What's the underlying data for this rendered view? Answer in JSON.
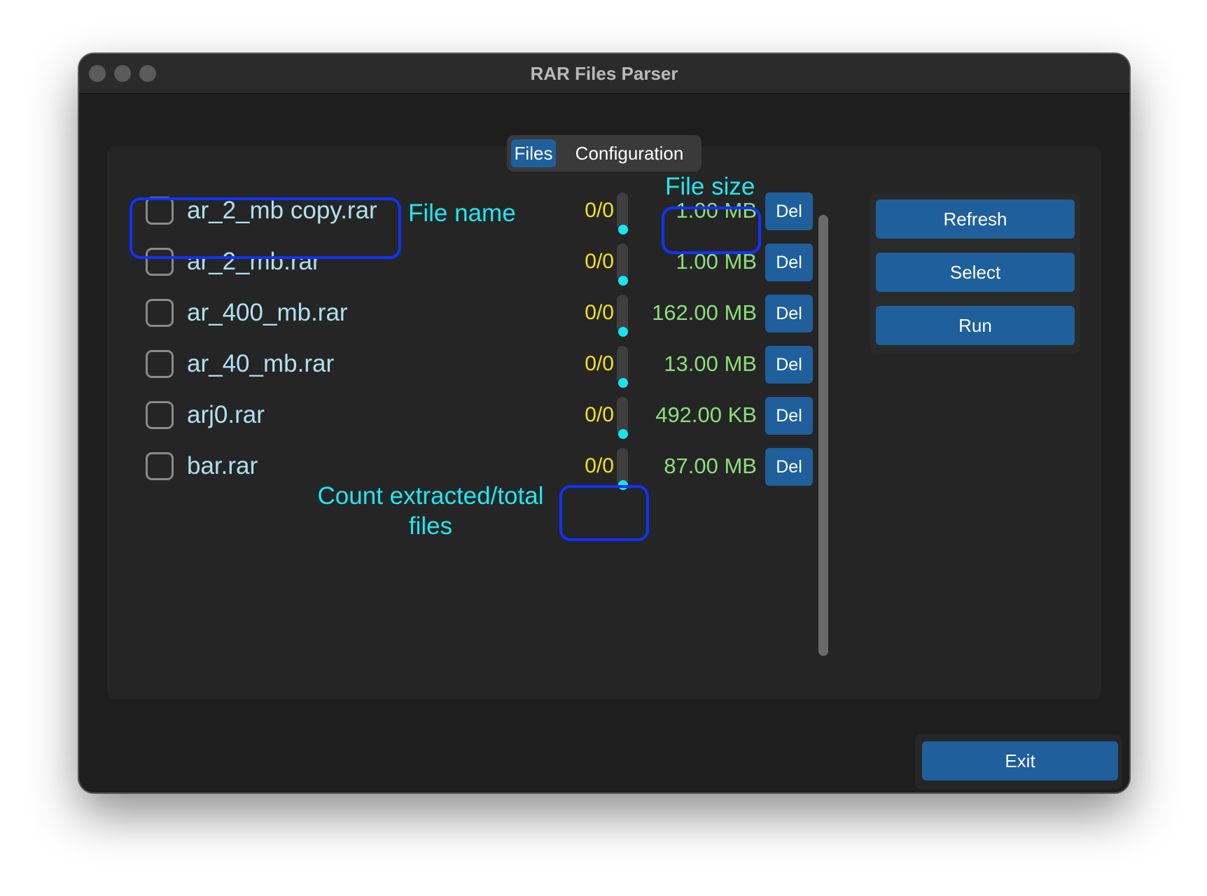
{
  "window": {
    "title": "RAR Files Parser"
  },
  "tabs": [
    {
      "label": "Files",
      "active": true
    },
    {
      "label": "Configuration",
      "active": false
    }
  ],
  "files": [
    {
      "name": "ar_2_mb copy.rar",
      "count": "0/0",
      "size": "1.00 MB",
      "checked": false
    },
    {
      "name": "ar_2_mb.rar",
      "count": "0/0",
      "size": "1.00 MB",
      "checked": false
    },
    {
      "name": "ar_400_mb.rar",
      "count": "0/0",
      "size": "162.00 MB",
      "checked": false
    },
    {
      "name": "ar_40_mb.rar",
      "count": "0/0",
      "size": "13.00 MB",
      "checked": false
    },
    {
      "name": "arj0.rar",
      "count": "0/0",
      "size": "492.00 KB",
      "checked": false
    },
    {
      "name": "bar.rar",
      "count": "0/0",
      "size": "87.00 MB",
      "checked": false
    }
  ],
  "row_button_label": "Del",
  "actions": {
    "refresh": "Refresh",
    "select": "Select",
    "run": "Run",
    "exit": "Exit"
  },
  "annotations": {
    "file_name": "File name",
    "file_size": "File size",
    "count_line1": "Count extracted/total",
    "count_line2": "files"
  },
  "colors": {
    "accent": "#1f5f9c",
    "count_text": "#f2e21f",
    "size_text": "#8be07a",
    "name_text": "#b0e0f0",
    "annotation": "#21e6f0",
    "highlight_box": "#1033ff"
  }
}
